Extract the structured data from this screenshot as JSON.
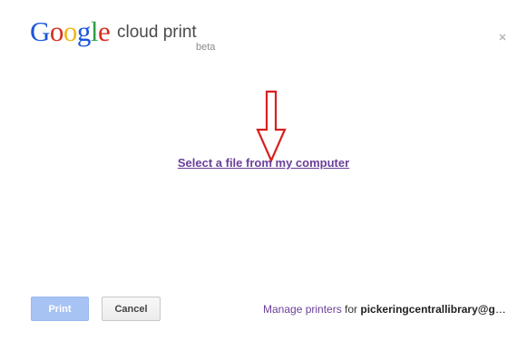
{
  "header": {
    "logo_letters": [
      {
        "ch": "G",
        "color": "#1a56db"
      },
      {
        "ch": "o",
        "color": "#d62d20"
      },
      {
        "ch": "o",
        "color": "#f1b817"
      },
      {
        "ch": "g",
        "color": "#1a56db"
      },
      {
        "ch": "l",
        "color": "#2c9f45"
      },
      {
        "ch": "e",
        "color": "#d62d20"
      }
    ],
    "product_name": "cloud print",
    "beta_label": "beta",
    "close_symbol": "×"
  },
  "main": {
    "file_link_label": "Select a file from my computer",
    "annotation_arrow_color": "#d81f1f"
  },
  "footer": {
    "print_label": "Print",
    "cancel_label": "Cancel",
    "manage_link_label": "Manage printers",
    "for_label": " for ",
    "account": "pickeringcentrallibrary@gm…"
  },
  "colors": {
    "link": "#6a3f9a",
    "print_button": "#a7c3f4"
  }
}
